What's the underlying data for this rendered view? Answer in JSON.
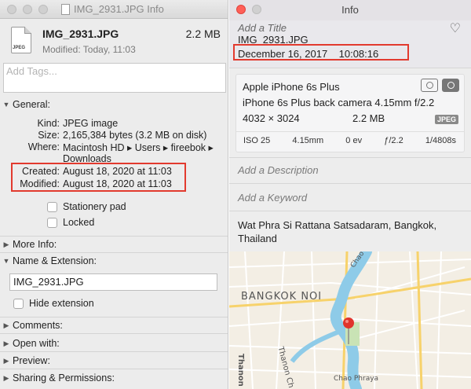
{
  "finder": {
    "title": "IMG_2931.JPG Info",
    "file_name": "IMG_2931.JPG",
    "file_size": "2.2 MB",
    "modified_summary": "Modified: Today, 11:03",
    "file_badge": "JPEG",
    "tags_placeholder": "Add Tags...",
    "general": {
      "header": "General:",
      "kind_label": "Kind:",
      "kind_value": "JPEG image",
      "size_label": "Size:",
      "size_value": "2,165,384 bytes (3.2 MB on disk)",
      "where_label": "Where:",
      "where_value_1": "Macintosh HD ▸ Users ▸ fireebok ▸",
      "where_value_2": "Downloads",
      "created_label": "Created:",
      "created_value": "August 18, 2020 at 11:03",
      "modified_label": "Modified:",
      "modified_value": "August 18, 2020 at 11:03",
      "stationery_label": "Stationery pad",
      "locked_label": "Locked"
    },
    "more_info": "More Info:",
    "name_ext": {
      "header": "Name & Extension:",
      "value": "IMG_2931.JPG",
      "hide_extension": "Hide extension"
    },
    "comments": "Comments:",
    "open_with": "Open with:",
    "preview": "Preview:",
    "sharing": "Sharing & Permissions:"
  },
  "photos": {
    "title": "Info",
    "add_title": "Add a Title",
    "file_name": "IMG_2931.JPG",
    "date": "December 16, 2017    10:08:16",
    "camera_model": "Apple iPhone 6s Plus",
    "lens": "iPhone 6s Plus back camera 4.15mm f/2.2",
    "dimensions": "4032 × 3024",
    "size": "2.2 MB",
    "format_badge": "JPEG",
    "exif": {
      "iso": "ISO 25",
      "focal": "4.15mm",
      "ev": "0 ev",
      "aperture": "ƒ/2.2",
      "shutter": "1/4808s"
    },
    "add_description": "Add a Description",
    "add_keyword": "Add a Keyword",
    "location": "Wat Phra Si Rattana Satsadaram, Bangkok, Thailand",
    "map": {
      "label_bangkok_noi": "BANGKOK NOI",
      "label_chao_phraya_1": "Chao Phraya",
      "label_chao_phraya_2": "Chao Phraya",
      "label_thanon_1": "Thanon Ch",
      "label_thanon_2": "Thanon Ch"
    }
  },
  "colors": {
    "highlight": "#e23a2e",
    "close_button": "#ff5f57",
    "river": "#8ecbe8",
    "pin": "#e0332b"
  }
}
